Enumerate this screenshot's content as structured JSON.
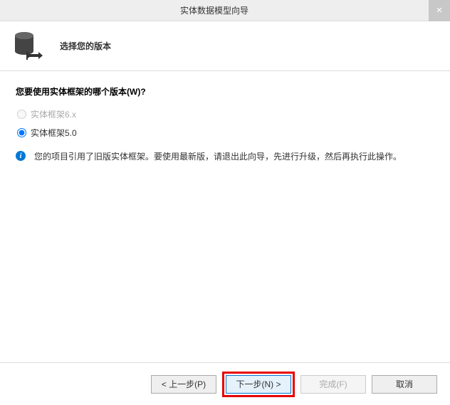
{
  "titlebar": {
    "title": "实体数据模型向导",
    "close_glyph": "×"
  },
  "header": {
    "title": "选择您的版本"
  },
  "content": {
    "question": "您要使用实体框架的哪个版本(W)?",
    "options": [
      {
        "label": "实体框架6.x",
        "checked": false,
        "disabled": true
      },
      {
        "label": "实体框架5.0",
        "checked": true,
        "disabled": false
      }
    ],
    "info_glyph": "i",
    "info_text": "您的项目引用了旧版实体框架。要使用最新版，请退出此向导，先进行升级，然后再执行此操作。"
  },
  "footer": {
    "prev": "< 上一步(P)",
    "next": "下一步(N) >",
    "finish": "完成(F)",
    "cancel": "取消"
  }
}
